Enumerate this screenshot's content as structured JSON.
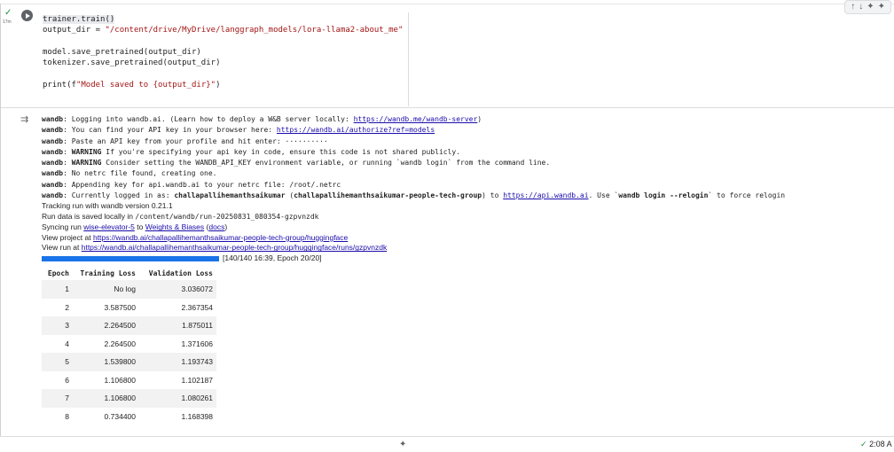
{
  "cell": {
    "exec_time": "17m",
    "code_lines": [
      {
        "pre": "",
        "hl": "trainer.train()",
        "str": "",
        "post": ""
      },
      {
        "pre": "output_dir = ",
        "hl": "",
        "str": "\"/content/drive/MyDrive/langgraph_models/lora-llama2-about_me\"",
        "post": ""
      },
      {
        "pre": "",
        "hl": "",
        "str": "",
        "post": ""
      },
      {
        "pre": "model.save_pretrained(output_dir)",
        "hl": "",
        "str": "",
        "post": ""
      },
      {
        "pre": "tokenizer.save_pretrained(output_dir)",
        "hl": "",
        "str": "",
        "post": ""
      },
      {
        "pre": "",
        "hl": "",
        "str": "",
        "post": ""
      },
      {
        "pre": "print(f",
        "hl": "",
        "str": "\"Model saved to {output_dir}\"",
        "post": ")"
      }
    ]
  },
  "output": {
    "log": [
      {
        "p": "wandb",
        "t": ": Logging into wandb.ai. (Learn how to deploy a W&B server locally: ",
        "link": "https://wandb.me/wandb-server",
        "after": ")"
      },
      {
        "p": "wandb",
        "t": ": You can find your API key in your browser here: ",
        "link": "https://wandb.ai/authorize?ref=models",
        "after": ""
      },
      {
        "p": "wandb",
        "t": ": Paste an API key from your profile and hit enter: ··········",
        "link": "",
        "after": ""
      },
      {
        "p": "wandb",
        "w": "WARNING",
        "t": " If you're specifying your api key in code, ensure this code is not shared publicly.",
        "link": "",
        "after": ""
      },
      {
        "p": "wandb",
        "w": "WARNING",
        "t": " Consider setting the WANDB_API_KEY environment variable, or running `wandb login` from the command line.",
        "link": "",
        "after": ""
      },
      {
        "p": "wandb",
        "t": ": No netrc file found, creating one.",
        "link": "",
        "after": ""
      },
      {
        "p": "wandb",
        "t": ": Appending key for api.wandb.ai to your netrc file: /root/.netrc",
        "link": "",
        "after": ""
      }
    ],
    "logged_in": {
      "p": "wandb",
      "t1": ": Currently logged in as: ",
      "user": "challapallihemanthsaikumar",
      "t2": " (",
      "org": "challapallihemanthsaikumar-people-tech-group",
      "t3": ") to ",
      "link": "https://api.wandb.ai",
      "t4": ". Use `",
      "cmd": "wandb login --relogin",
      "t5": "` to force relogin"
    },
    "tracking": "Tracking run with wandb version 0.21.1",
    "run_saved": "Run data is saved locally in ",
    "run_path": "/content/wandb/run-20250831_080354-gzpvnzdk",
    "syncing_pre": "Syncing run ",
    "run_name": "wise-elevator-5",
    "syncing_mid": " to ",
    "wb_link": "Weights & Biases",
    "docs_pre": " (",
    "docs": "docs",
    "docs_post": ")",
    "project_pre": "View project at ",
    "project_link": "https://wandb.ai/challapallihemanthsaikumar-people-tech-group/huggingface",
    "run_pre": "View run at ",
    "run_link": "https://wandb.ai/challapallihemanthsaikumar-people-tech-group/huggingface/runs/gzpvnzdk",
    "progress_fraction": 1.0,
    "progress_text": "[140/140 16:39, Epoch 20/20]",
    "table": {
      "headers": [
        "Epoch",
        "Training Loss",
        "Validation Loss"
      ],
      "rows": [
        [
          "1",
          "No log",
          "3.036072"
        ],
        [
          "2",
          "3.587500",
          "2.367354"
        ],
        [
          "3",
          "2.264500",
          "1.875011"
        ],
        [
          "4",
          "2.264500",
          "1.371606"
        ],
        [
          "5",
          "1.539800",
          "1.193743"
        ],
        [
          "6",
          "1.106800",
          "1.102187"
        ],
        [
          "7",
          "1.106800",
          "1.080261"
        ],
        [
          "8",
          "0.734400",
          "1.168398"
        ]
      ]
    }
  },
  "footer": {
    "status": "2:08 A"
  }
}
